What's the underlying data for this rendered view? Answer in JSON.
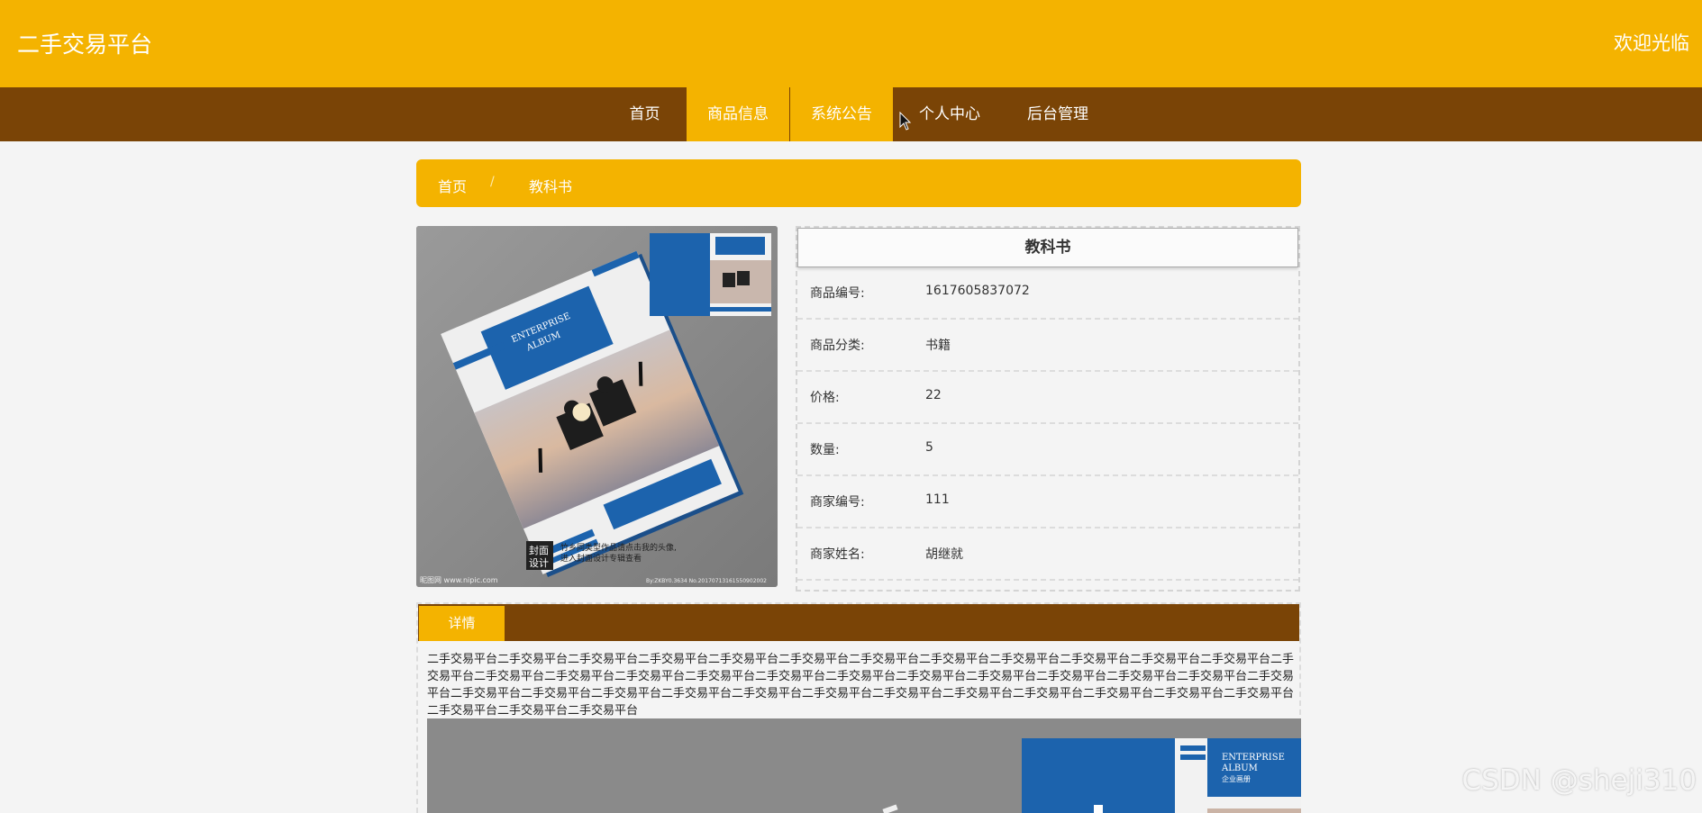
{
  "header": {
    "site_title": "二手交易平台",
    "welcome": "欢迎光临"
  },
  "nav": {
    "items": [
      {
        "label": "首页"
      },
      {
        "label": "商品信息"
      },
      {
        "label": "系统公告"
      },
      {
        "label": "个人中心"
      },
      {
        "label": "后台管理"
      }
    ],
    "active": "商品信息"
  },
  "breadcrumb": {
    "home": "首页",
    "separator": "/",
    "current": "教科书"
  },
  "product": {
    "title": "教科书",
    "image_icon": "book-cover-image",
    "image_text": {
      "cover_title_1": "ENTERPRISE",
      "cover_title_2": "ALBUM",
      "cover_subtitle": "企业画册",
      "footer_left": "昵图网 www.nipic.com",
      "footer_right": "By:ZKBY0.3634 No.20170713161550902002",
      "stamp_line1": "封面",
      "stamp_line2": "设计",
      "tagline_1": "竹乡同类型作品请点击我的头像,",
      "tagline_2": "进入封面设计专辑查看"
    },
    "fields": [
      {
        "label": "商品编号:",
        "value": "1617605837072"
      },
      {
        "label": "商品分类:",
        "value": "书籍"
      },
      {
        "label": "价格:",
        "value": "22"
      },
      {
        "label": "数量:",
        "value": "5"
      },
      {
        "label": "商家编号:",
        "value": "111"
      },
      {
        "label": "商家姓名:",
        "value": "胡继就"
      }
    ]
  },
  "detail": {
    "tab_label": "详情",
    "text": "二手交易平台二手交易平台二手交易平台二手交易平台二手交易平台二手交易平台二手交易平台二手交易平台二手交易平台二手交易平台二手交易平台二手交易平台二手交易平台二手交易平台二手交易平台二手交易平台二手交易平台二手交易平台二手交易平台二手交易平台二手交易平台二手交易平台二手交易平台二手交易平台二手交易平台二手交易平台二手交易平台二手交易平台二手交易平台二手交易平台二手交易平台二手交易平台二手交易平台二手交易平台二手交易平台二手交易平台二手交易平台二手交易平台二手交易平台二手交易平台",
    "image_text": {
      "cover_title_1": "ENTERPRISE",
      "cover_title_2": "ALBUM",
      "cover_subtitle": "企业画册"
    }
  },
  "watermark": "CSDN @sheji310",
  "colors": {
    "header_bg": "#f4b300",
    "nav_bg": "#7a4406",
    "page_bg": "#f4f4f4",
    "cover_blue": "#1c63ad"
  }
}
